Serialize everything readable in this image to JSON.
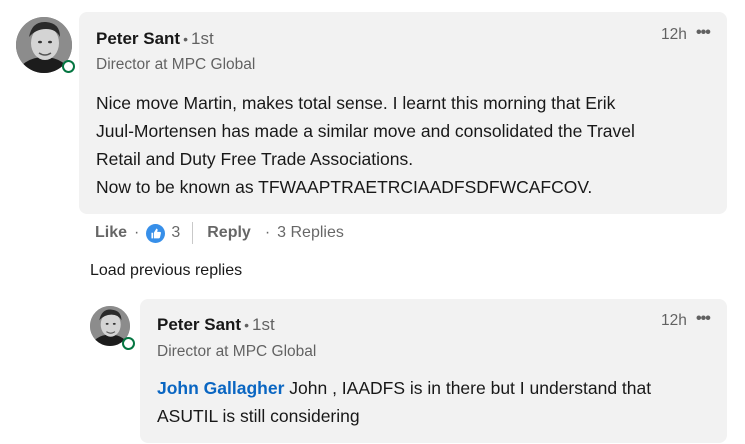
{
  "comment": {
    "author_name": "Peter Sant",
    "degree": "1st",
    "headline": "Director at MPC Global",
    "time": "12h",
    "more_icon": "•••",
    "text_lines": [
      "Nice move Martin, makes total sense. I learnt this morning that Erik",
      "Juul-Mortensen has made a similar move and consolidated the Travel",
      "Retail and Duty Free Trade Associations.",
      "Now to be known as TFWAAPTRAETRCIAADFSDFWCAFCOV."
    ],
    "like_label": "Like",
    "reaction_count": "3",
    "reply_label": "Reply",
    "replies_label": "3 Replies"
  },
  "load_previous_label": "Load previous replies",
  "reply": {
    "author_name": "Peter Sant",
    "degree": "1st",
    "headline": "Director at MPC Global",
    "time": "12h",
    "more_icon": "•••",
    "mention": "John Gallagher",
    "text_line1_rest": " John , IAADFS is in there but I understand that",
    "text_line2": "ASUTIL is still considering"
  },
  "colors": {
    "bubble": "#f2f2f2",
    "mention": "#0a66c2",
    "like_badge": "#378fe9",
    "presence": "#057642"
  }
}
